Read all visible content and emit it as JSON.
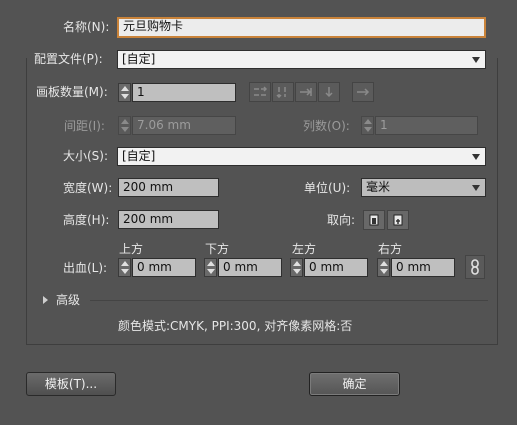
{
  "dialog": {
    "name_label": "名称(N):",
    "name_value": "元旦购物卡",
    "profile_label": "配置文件(P):",
    "profile_value": "[自定]",
    "artboards_label": "画板数量(M):",
    "artboards_value": "1",
    "spacing_label": "间距(I):",
    "spacing_value": "7.06 mm",
    "columns_label": "列数(O):",
    "columns_value": "1",
    "size_label": "大小(S):",
    "size_value": "[自定]",
    "width_label": "宽度(W):",
    "width_value": "200 mm",
    "units_label": "单位(U):",
    "units_value": "毫米",
    "height_label": "高度(H):",
    "height_value": "200 mm",
    "orientation_label": "取向:",
    "bleed_label": "出血(L):",
    "bleed": {
      "top_label": "上方",
      "top_value": "0 mm",
      "bottom_label": "下方",
      "bottom_value": "0 mm",
      "left_label": "左方",
      "left_value": "0 mm",
      "right_label": "右方",
      "right_value": "0 mm"
    },
    "advanced_label": "高级",
    "summary": "颜色模式:CMYK, PPI:300, 对齐像素网格:否",
    "templates_button": "模板(T)...",
    "ok_button": "确定"
  },
  "icons": [
    "grid-by-row-icon",
    "grid-by-column-icon",
    "arrange-by-row-icon",
    "arrange-by-column-icon",
    "right-to-left-icon",
    "portrait-icon",
    "landscape-icon",
    "link-icon",
    "disclosure-triangle-icon"
  ]
}
